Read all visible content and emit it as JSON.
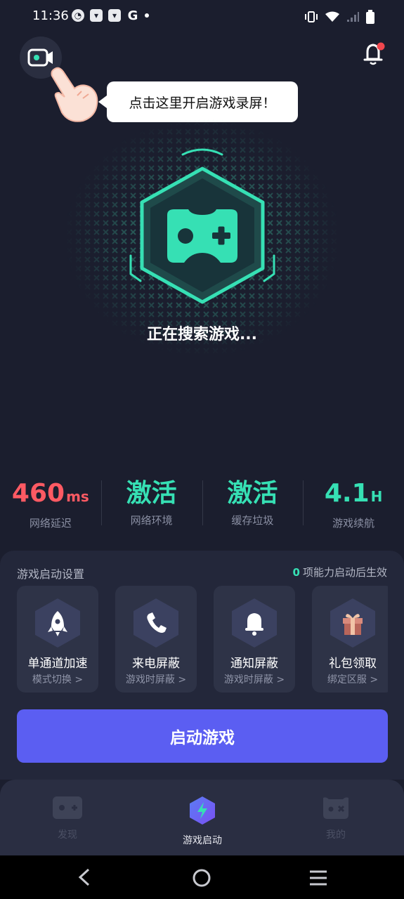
{
  "status_bar": {
    "time": "11:36"
  },
  "tooltip": {
    "text": "点击这里开启游戏录屏！"
  },
  "hero": {
    "status_text": "正在搜索游戏..."
  },
  "stats": [
    {
      "value": "460",
      "unit": "ms",
      "label": "网络延迟",
      "color": "#ff5a63"
    },
    {
      "value": "激活",
      "unit": "",
      "label": "网络环境",
      "color": "#36e0b4"
    },
    {
      "value": "激活",
      "unit": "",
      "label": "缓存垃圾",
      "color": "#36e0b4"
    },
    {
      "value": "4.1",
      "unit": "H",
      "label": "游戏续航",
      "color": "#36e0b4"
    }
  ],
  "settings": {
    "title": "游戏启动设置",
    "note_count": "0",
    "note_text": "项能力启动后生效",
    "cards": [
      {
        "title": "单通道加速",
        "subtitle": "模式切换 >",
        "icon": "rocket-icon"
      },
      {
        "title": "来电屏蔽",
        "subtitle": "游戏时屏蔽 >",
        "icon": "phone-icon"
      },
      {
        "title": "通知屏蔽",
        "subtitle": "游戏时屏蔽 >",
        "icon": "bell-icon"
      },
      {
        "title": "礼包领取",
        "subtitle": "绑定区服 >",
        "icon": "gift-icon"
      }
    ]
  },
  "start_button": {
    "label": "启动游戏"
  },
  "tabs": [
    {
      "label": "发现",
      "icon": "gamepad-icon",
      "active": false
    },
    {
      "label": "游戏启动",
      "icon": "lightning-icon",
      "active": true
    },
    {
      "label": "我的",
      "icon": "profile-gamepad-icon",
      "active": false
    }
  ],
  "colors": {
    "accent": "#36e0b4",
    "primary_button": "#5b5ef2",
    "latency": "#ff5a63",
    "background": "#1b1e2e"
  }
}
